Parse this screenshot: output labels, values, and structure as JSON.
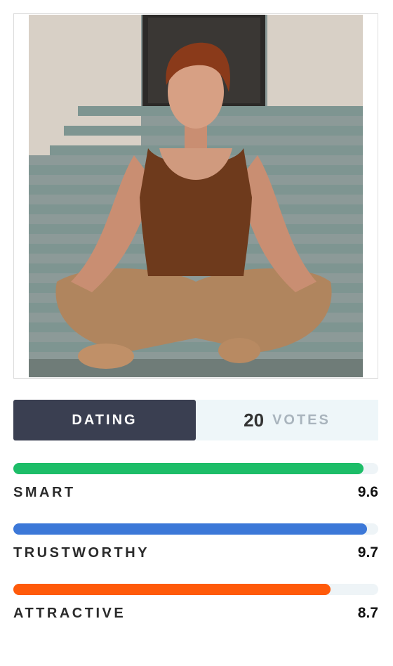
{
  "photo": {
    "alt": "Woman sitting cross-legged on steps"
  },
  "category": {
    "label": "DATING"
  },
  "votes": {
    "count": "20",
    "label": "VOTES"
  },
  "metrics": [
    {
      "label": "SMART",
      "value": "9.6",
      "level": 0.96,
      "color": "#1dbd68"
    },
    {
      "label": "TRUSTWORTHY",
      "value": "9.7",
      "level": 0.97,
      "color": "#3c78d8"
    },
    {
      "label": "ATTRACTIVE",
      "value": "8.7",
      "level": 0.87,
      "color": "#ff5a0a"
    }
  ]
}
